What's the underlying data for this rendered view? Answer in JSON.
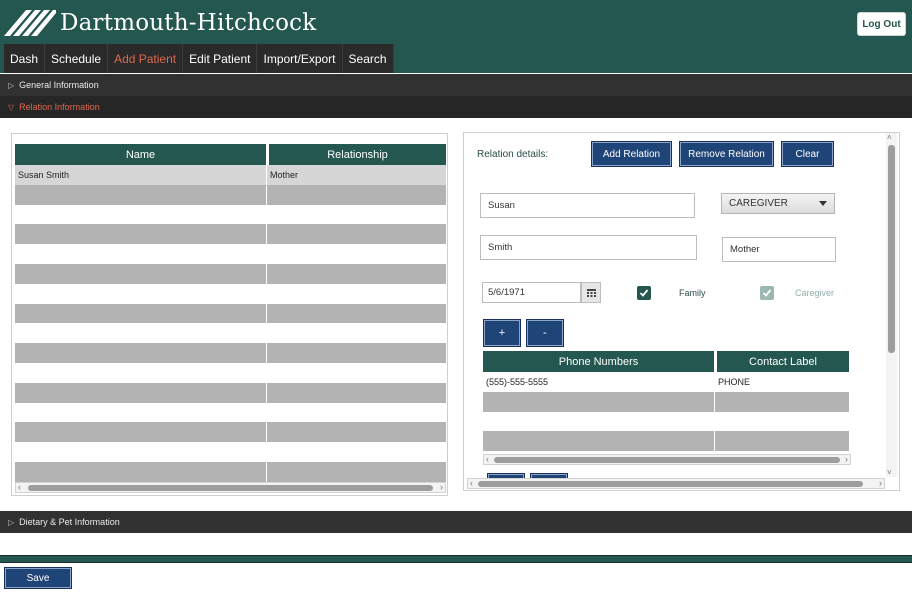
{
  "header": {
    "brand": "Dartmouth-Hitchcock",
    "logout_label": "Log Out",
    "logo_icon": "slash-stripes-logo-icon"
  },
  "nav": {
    "tabs": [
      {
        "label": "Dash",
        "active": false
      },
      {
        "label": "Schedule",
        "active": false
      },
      {
        "label": "Add Patient",
        "active": true
      },
      {
        "label": "Edit Patient",
        "active": false
      },
      {
        "label": "Import/Export",
        "active": false
      },
      {
        "label": "Search",
        "active": false
      }
    ]
  },
  "sections": {
    "general": "General Information",
    "relation": "Relation Information",
    "dietary": "Dietary & Pet Information"
  },
  "relations_table": {
    "columns": [
      "Name",
      "Relationship"
    ],
    "rows": [
      {
        "name": "Susan Smith",
        "relationship": "Mother"
      }
    ]
  },
  "relation_details": {
    "label": "Relation details:",
    "add_button": "Add Relation",
    "remove_button": "Remove Relation",
    "clear_button": "Clear",
    "first_name": "Susan",
    "last_name": "Smith",
    "role_select": "CAREGIVER",
    "relationship": "Mother",
    "dob": "5/6/1971",
    "family_label": "Family",
    "family_checked": true,
    "caregiver_label": "Caregiver",
    "caregiver_checked": true,
    "plus_button": "+",
    "minus_button": "-"
  },
  "phone_table": {
    "columns": [
      "Phone Numbers",
      "Contact Label"
    ],
    "rows": [
      {
        "phone": "(555)-555-5555",
        "label": "PHONE"
      }
    ]
  },
  "footer": {
    "save_label": "Save"
  },
  "colors": {
    "brand_green": "#24574f",
    "button_blue": "#1f4478",
    "active_tab": "#e0684f"
  }
}
